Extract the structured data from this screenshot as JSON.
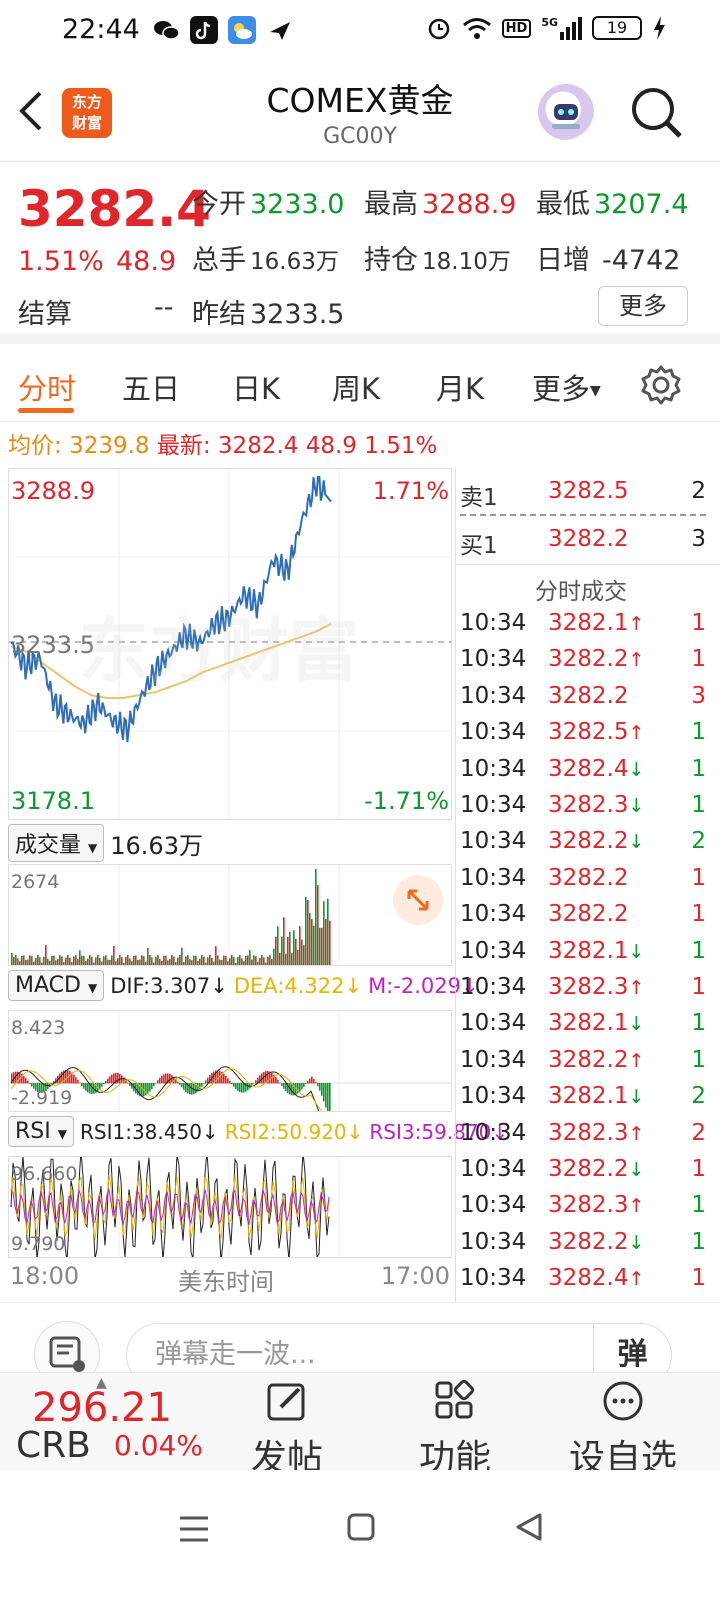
{
  "status_bar": {
    "time": "22:44",
    "battery": "19",
    "network": "5G",
    "hd": "HD"
  },
  "header": {
    "logo_text": "东方\n财富",
    "title": "COMEX黄金",
    "code": "GC00Y"
  },
  "quote": {
    "price": "3282.4",
    "change_pct": "1.51%",
    "change": "48.9",
    "open_label": "今开",
    "open": "3233.0",
    "high_label": "最高",
    "high": "3288.9",
    "low_label": "最低",
    "low": "3207.4",
    "volume_label": "总手",
    "volume": "16.63万",
    "oi_label": "持仓",
    "oi": "18.10万",
    "daily_inc_label": "日增",
    "daily_inc": "-4742",
    "settle_label": "结算",
    "settle": "--",
    "prev_settle_label": "昨结",
    "prev_settle": "3233.5",
    "more_label": "更多"
  },
  "tabs": [
    "分时",
    "五日",
    "日K",
    "周K",
    "月K",
    "更多"
  ],
  "avg_line": {
    "avg_label": "均价:",
    "avg": "3239.8",
    "latest_label": "最新:",
    "latest": "3282.4",
    "chg": "48.9",
    "pct": "1.51%"
  },
  "chart": {
    "top_price": "3288.9",
    "top_pct": "1.71%",
    "mid_price": "3233.5",
    "bottom_price": "3178.1",
    "bottom_pct": "-1.71%",
    "watermark": "东方财富",
    "vol_label": "成交量",
    "vol_value": "16.63万",
    "vol_max": "2674",
    "macd_label": "MACD",
    "dif": "DIF:3.307",
    "dea": "DEA:4.322",
    "m": "M:-2.029",
    "macd_max": "8.423",
    "macd_min": "-2.919",
    "rsi_label": "RSI",
    "rsi1": "RSI1:38.450",
    "rsi2": "RSI2:50.920",
    "rsi3": "RSI3:59.870",
    "rsi_max": "96.660",
    "rsi_min": "9.790",
    "time_start": "18:00",
    "time_mid": "美东时间",
    "time_end": "17:00"
  },
  "chart_data": {
    "type": "line",
    "x": [
      "18:00",
      "17:00"
    ],
    "series": [
      {
        "values": [
          3233,
          3225,
          3228,
          3212,
          3208,
          3205,
          3212,
          3206,
          3203,
          3215,
          3224,
          3230,
          3236,
          3233,
          3240,
          3242,
          3250,
          3246,
          3262,
          3258,
          3276,
          3288.9,
          3282.4
        ]
      },
      {
        "values": [
          3232,
          3230,
          3226,
          3222,
          3218,
          3215,
          3214,
          3214,
          3215,
          3216,
          3218,
          3220,
          3223,
          3225,
          3227,
          3229,
          3231,
          3233,
          3235,
          3237,
          3239.8
        ]
      }
    ],
    "ylim": [
      3178.1,
      3288.9
    ]
  },
  "orderbook": [
    {
      "name": "卖1",
      "price": "3282.5",
      "qty": "2"
    },
    {
      "name": "买1",
      "price": "3282.2",
      "qty": "3"
    }
  ],
  "trades_title": "分时成交",
  "trades": [
    {
      "time": "10:34",
      "price": "3282.1",
      "dir": "↑",
      "qty": "1",
      "qcolor": "red"
    },
    {
      "time": "10:34",
      "price": "3282.2",
      "dir": "↑",
      "qty": "1",
      "qcolor": "red"
    },
    {
      "time": "10:34",
      "price": "3282.2",
      "dir": "",
      "qty": "3",
      "qcolor": "red"
    },
    {
      "time": "10:34",
      "price": "3282.5",
      "dir": "↑",
      "qty": "1",
      "qcolor": "green"
    },
    {
      "time": "10:34",
      "price": "3282.4",
      "dir": "↓",
      "qty": "1",
      "qcolor": "green"
    },
    {
      "time": "10:34",
      "price": "3282.3",
      "dir": "↓",
      "qty": "1",
      "qcolor": "green"
    },
    {
      "time": "10:34",
      "price": "3282.2",
      "dir": "↓",
      "qty": "2",
      "qcolor": "green"
    },
    {
      "time": "10:34",
      "price": "3282.2",
      "dir": "",
      "qty": "1",
      "qcolor": "red"
    },
    {
      "time": "10:34",
      "price": "3282.2",
      "dir": "",
      "qty": "1",
      "qcolor": "red"
    },
    {
      "time": "10:34",
      "price": "3282.1",
      "dir": "↓",
      "qty": "1",
      "qcolor": "green"
    },
    {
      "time": "10:34",
      "price": "3282.3",
      "dir": "↑",
      "qty": "1",
      "qcolor": "red"
    },
    {
      "time": "10:34",
      "price": "3282.1",
      "dir": "↓",
      "qty": "1",
      "qcolor": "green"
    },
    {
      "time": "10:34",
      "price": "3282.2",
      "dir": "↑",
      "qty": "1",
      "qcolor": "green"
    },
    {
      "time": "10:34",
      "price": "3282.1",
      "dir": "↓",
      "qty": "2",
      "qcolor": "green"
    },
    {
      "time": "10:34",
      "price": "3282.3",
      "dir": "↑",
      "qty": "2",
      "qcolor": "red"
    },
    {
      "time": "10:34",
      "price": "3282.2",
      "dir": "↓",
      "qty": "1",
      "qcolor": "red"
    },
    {
      "time": "10:34",
      "price": "3282.3",
      "dir": "↑",
      "qty": "1",
      "qcolor": "green"
    },
    {
      "time": "10:34",
      "price": "3282.2",
      "dir": "↓",
      "qty": "1",
      "qcolor": "green"
    },
    {
      "time": "10:34",
      "price": "3282.4",
      "dir": "↑",
      "qty": "1",
      "qcolor": "red"
    }
  ],
  "comment": {
    "placeholder": "弹幕走一波...",
    "danmu": "弹"
  },
  "bottom": {
    "crb_value": "296.21",
    "crb_name": "CRB",
    "crb_pct": "0.04%",
    "post": "发帖",
    "func": "功能",
    "watch": "设自选"
  }
}
